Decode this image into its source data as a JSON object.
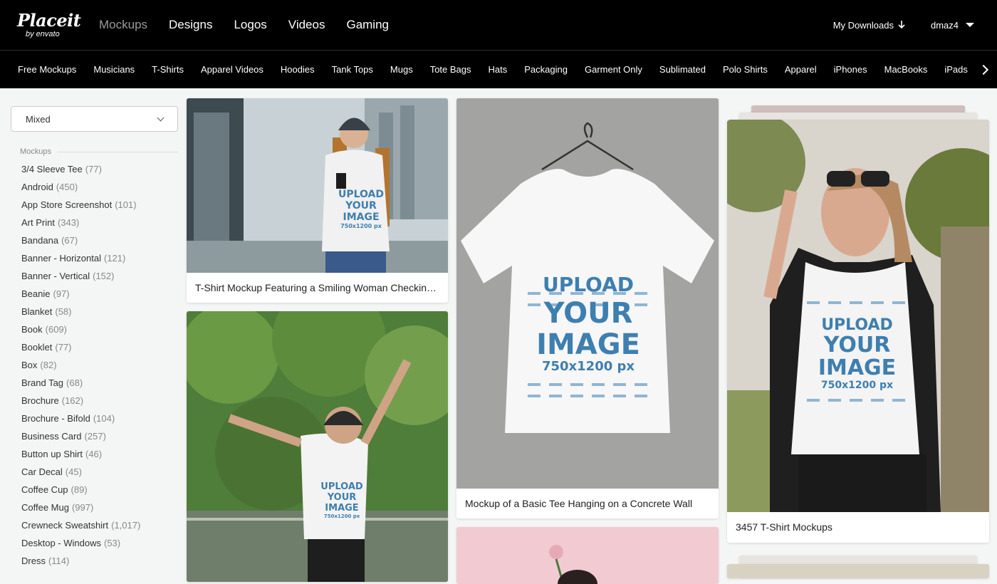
{
  "header": {
    "logo": {
      "brand": "Placeit",
      "by": "by envato"
    },
    "nav": [
      {
        "label": "Mockups",
        "active": true
      },
      {
        "label": "Designs",
        "active": false
      },
      {
        "label": "Logos",
        "active": false
      },
      {
        "label": "Videos",
        "active": false
      },
      {
        "label": "Gaming",
        "active": false
      }
    ],
    "downloads_label": "My Downloads",
    "user_label": "dmaz4"
  },
  "categories": [
    "Free Mockups",
    "Musicians",
    "T-Shirts",
    "Apparel Videos",
    "Hoodies",
    "Tank Tops",
    "Mugs",
    "Tote Bags",
    "Hats",
    "Packaging",
    "Garment Only",
    "Sublimated",
    "Polo Shirts",
    "Apparel",
    "iPhones",
    "MacBooks",
    "iPads"
  ],
  "sidebar": {
    "sort_value": "Mixed",
    "section_title": "Mockups",
    "filters": [
      {
        "label": "3/4 Sleeve Tee",
        "count": "(77)"
      },
      {
        "label": "Android",
        "count": "(450)"
      },
      {
        "label": "App Store Screenshot",
        "count": "(101)"
      },
      {
        "label": "Art Print",
        "count": "(343)"
      },
      {
        "label": "Bandana",
        "count": "(67)"
      },
      {
        "label": "Banner - Horizontal",
        "count": "(121)"
      },
      {
        "label": "Banner - Vertical",
        "count": "(152)"
      },
      {
        "label": "Beanie",
        "count": "(97)"
      },
      {
        "label": "Blanket",
        "count": "(58)"
      },
      {
        "label": "Book",
        "count": "(609)"
      },
      {
        "label": "Booklet",
        "count": "(77)"
      },
      {
        "label": "Box",
        "count": "(82)"
      },
      {
        "label": "Brand Tag",
        "count": "(68)"
      },
      {
        "label": "Brochure",
        "count": "(162)"
      },
      {
        "label": "Brochure - Bifold",
        "count": "(104)"
      },
      {
        "label": "Business Card",
        "count": "(257)"
      },
      {
        "label": "Button up Shirt",
        "count": "(46)"
      },
      {
        "label": "Car Decal",
        "count": "(45)"
      },
      {
        "label": "Coffee Cup",
        "count": "(89)"
      },
      {
        "label": "Coffee Mug",
        "count": "(997)"
      },
      {
        "label": "Crewneck Sweatshirt",
        "count": "(1,017)"
      },
      {
        "label": "Desktop - Windows",
        "count": "(53)"
      },
      {
        "label": "Dress",
        "count": "(114)"
      }
    ]
  },
  "cards": {
    "card1": {
      "caption": "T-Shirt Mockup Featuring a Smiling Woman Checking Her Phone"
    },
    "card2": {
      "caption": "Mockup of a Basic Tee Hanging on a Concrete Wall"
    },
    "card3": {
      "caption": "3457 T-Shirt Mockups"
    }
  },
  "tee_print": {
    "line1": "UPLOAD",
    "line2": "YOUR",
    "line3": "IMAGE",
    "line4": "750x1200 px"
  },
  "colors": {
    "header_bg": "#000000",
    "page_bg": "#f4f5f5",
    "print_blue": "#3e7fb0"
  }
}
